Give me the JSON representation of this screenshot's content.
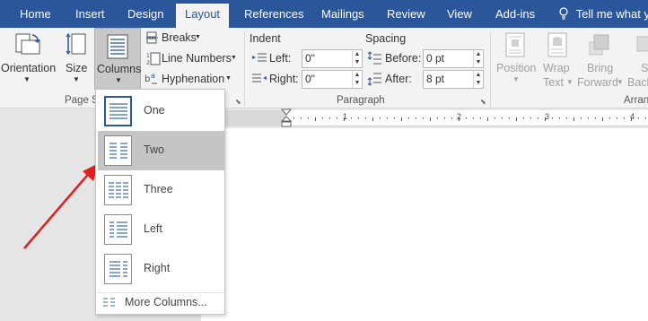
{
  "tabs": [
    {
      "label": "Home"
    },
    {
      "label": "Insert"
    },
    {
      "label": "Design"
    },
    {
      "label": "Layout",
      "active": true
    },
    {
      "label": "References"
    },
    {
      "label": "Mailings"
    },
    {
      "label": "Review"
    },
    {
      "label": "View"
    },
    {
      "label": "Add-ins"
    }
  ],
  "tell_me": "Tell me what y",
  "page_setup": {
    "orientation": "Orientation",
    "size": "Size",
    "columns": "Columns",
    "breaks": "Breaks",
    "line_numbers": "Line Numbers",
    "hyphenation": "Hyphenation",
    "group_label": "Page S"
  },
  "paragraph": {
    "indent_header": "Indent",
    "spacing_header": "Spacing",
    "left_label": "Left:",
    "right_label": "Right:",
    "before_label": "Before:",
    "after_label": "After:",
    "left_value": "0\"",
    "right_value": "0\"",
    "before_value": "0 pt",
    "after_value": "8 pt",
    "group_label": "Paragraph"
  },
  "arrange": {
    "position": "Position",
    "wrap_text_1": "Wrap",
    "wrap_text_2": "Text",
    "bring_forward_1": "Bring",
    "bring_forward_2": "Forward",
    "send_backward_1": "S",
    "send_backward_2": "Back",
    "group_label": "Arran"
  },
  "columns_menu": {
    "items": [
      {
        "label": "One"
      },
      {
        "label": "Two"
      },
      {
        "label": "Three"
      },
      {
        "label": "Left"
      },
      {
        "label": "Right"
      }
    ],
    "more": "More Columns..."
  },
  "ruler": {
    "ticks": [
      "1",
      "2",
      "3",
      "4"
    ]
  },
  "colors": {
    "accent": "#2b579a",
    "hover": "#c5c5c5",
    "arrow": "#e02020"
  }
}
